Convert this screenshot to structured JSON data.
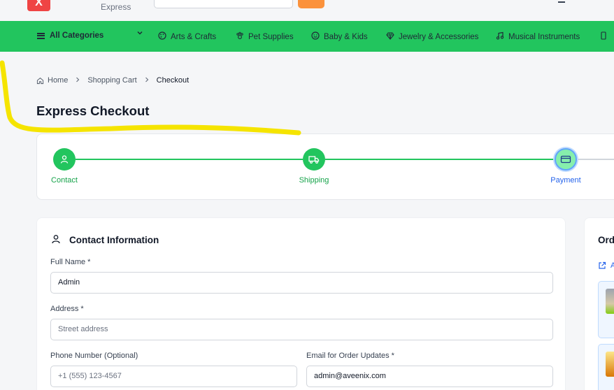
{
  "header": {
    "logo_letter": "X",
    "logo_subtitle": "Express"
  },
  "categories": {
    "all_label": "All Categories",
    "items": [
      {
        "label": "Arts & Crafts",
        "icon": "palette-icon"
      },
      {
        "label": "Pet Supplies",
        "icon": "paw-icon"
      },
      {
        "label": "Baby & Kids",
        "icon": "smile-icon"
      },
      {
        "label": "Jewelry & Accessories",
        "icon": "gem-icon"
      },
      {
        "label": "Musical Instruments",
        "icon": "music-note-icon"
      }
    ]
  },
  "breadcrumb": {
    "home": "Home",
    "cart": "Shopping Cart",
    "current": "Checkout"
  },
  "page_title": "Express Checkout",
  "steps": [
    {
      "label": "Contact",
      "state": "complete"
    },
    {
      "label": "Shipping",
      "state": "complete"
    },
    {
      "label": "Payment",
      "state": "active"
    }
  ],
  "contact": {
    "heading": "Contact Information",
    "full_name_label": "Full Name *",
    "full_name_value": "Admin",
    "address_label": "Address *",
    "address_placeholder": "Street address",
    "phone_label": "Phone Number (Optional)",
    "phone_placeholder": "+1 (555) 123-4567",
    "email_label": "Email for Order Updates *",
    "email_value": "admin@aveenix.com"
  },
  "order": {
    "title": "Ord",
    "link_text": "A"
  },
  "colors": {
    "nav_green": "#22c55e",
    "step_active_blue": "#2563eb",
    "highlighter": "#f5e400",
    "logo_red": "#ef4444",
    "search_orange": "#fb923c"
  }
}
